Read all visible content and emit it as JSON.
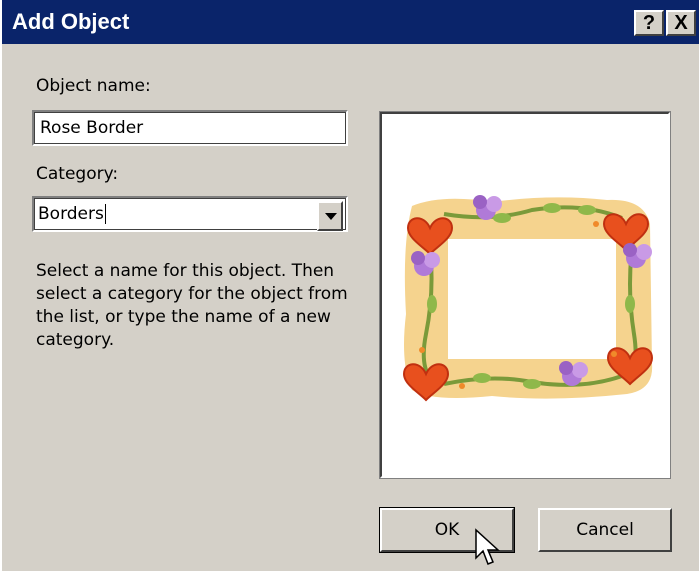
{
  "window": {
    "title": "Add Object",
    "help_button": "?",
    "close_button": "X"
  },
  "form": {
    "object_name_label": "Object name:",
    "object_name_value": "Rose Border",
    "category_label": "Category:",
    "category_value": "Borders",
    "description": "Select a name for this object. Then select a category for the object from the list, or type the name of a new category."
  },
  "buttons": {
    "ok": "OK",
    "cancel": "Cancel"
  },
  "icons": {
    "dropdown": "chevron-down-icon",
    "cursor": "mouse-pointer-icon"
  },
  "colors": {
    "titlebar": "#0a246a",
    "dialog_bg": "#d4d0c8",
    "heart": "#e8501e",
    "rose": "#b07ad8",
    "band": "#f5d38e"
  }
}
